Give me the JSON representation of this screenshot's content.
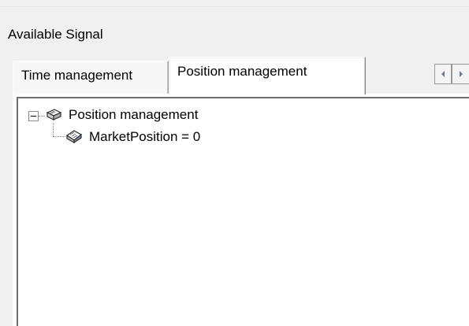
{
  "group": {
    "label": "Available Signal"
  },
  "tabs": [
    {
      "label": "Time management",
      "active": false
    },
    {
      "label": "Position management",
      "active": true
    }
  ],
  "tab_scroll": {
    "left_icon": "arrow-left-icon",
    "right_icon": "arrow-right-icon"
  },
  "tree": {
    "root": {
      "label": "Position management",
      "icon": "book-icon",
      "expanded": true
    },
    "children": [
      {
        "label": "MarketPosition = 0",
        "icon": "open-book-icon"
      }
    ]
  }
}
